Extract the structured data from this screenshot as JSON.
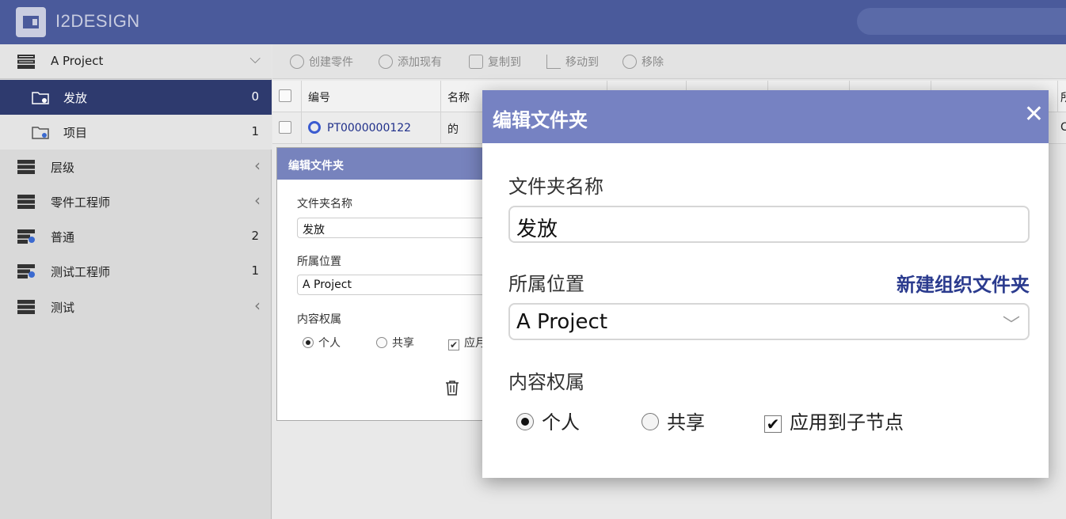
{
  "app": {
    "title": "I2DESIGN"
  },
  "sidebar": {
    "project": {
      "label": "A Project",
      "chevron": "⌵"
    },
    "items": [
      {
        "label": "发放",
        "count": "0"
      },
      {
        "label": "项目",
        "count": "1"
      },
      {
        "label": "层级",
        "chevron": "‹"
      },
      {
        "label": "零件工程师",
        "chevron": "‹"
      },
      {
        "label": "普通",
        "count": "2"
      },
      {
        "label": "测试工程师",
        "count": "1"
      },
      {
        "label": "测试",
        "chevron": "‹"
      }
    ]
  },
  "toolbar": {
    "create_part": "创建零件",
    "add_existing": "添加现有",
    "copy_to": "复制到",
    "move_to": "移动到",
    "remove": "移除"
  },
  "grid": {
    "headers": [
      "编号",
      "名称"
    ],
    "right_header": "所",
    "rows": [
      {
        "number": "PT0000000122",
        "name": "的",
        "right": "C"
      }
    ]
  },
  "small_dialog": {
    "title": "编辑文件夹",
    "folder_name_label": "文件夹名称",
    "folder_name_value": "发放",
    "location_label": "所属位置",
    "location_value": "A Project",
    "ownership_label": "内容权属",
    "opt_personal": "个人",
    "opt_shared": "共享",
    "opt_apply_partial": "应月"
  },
  "edit_folder_dialog": {
    "title": "编辑文件夹",
    "close_glyph": "✕",
    "folder_name_label": "文件夹名称",
    "folder_name_value": "发放",
    "location_label": "所属位置",
    "new_org_folder_link": "新建组织文件夹",
    "location_value": "A Project",
    "ownership_label": "内容权属",
    "opt_personal": "个人",
    "opt_shared": "共享",
    "opt_apply_children": "应用到子节点",
    "check_glyph": "✔",
    "select_chevron": "﹀"
  }
}
